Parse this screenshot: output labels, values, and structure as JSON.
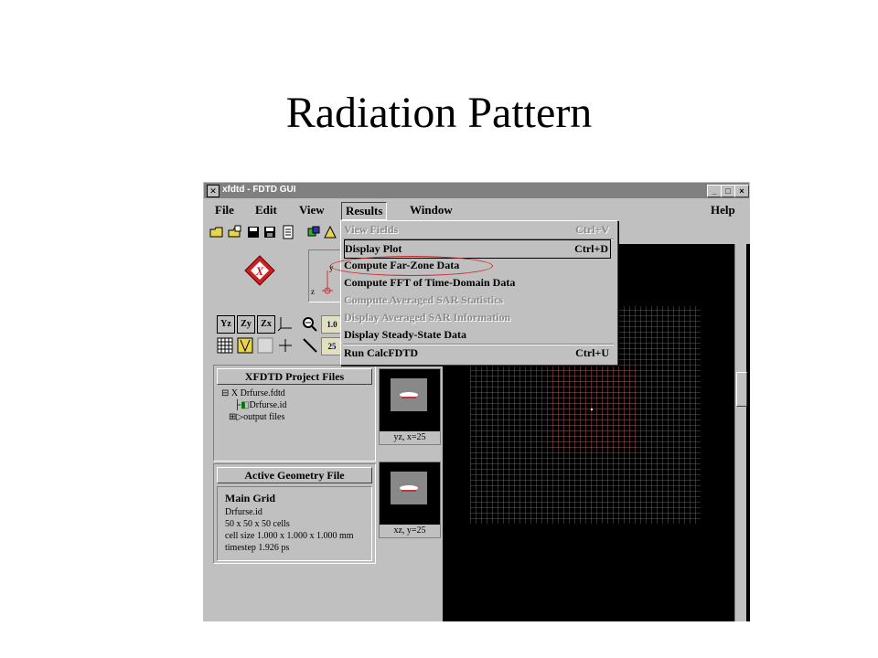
{
  "slide": {
    "title": "Radiation Pattern"
  },
  "window": {
    "title": "xfdtd - FDTD GUI",
    "controls": [
      "_",
      "□",
      "×"
    ]
  },
  "menubar": {
    "file": "File",
    "edit": "Edit",
    "view": "View",
    "results": "Results",
    "window": "Window",
    "help": "Help"
  },
  "results_menu": {
    "items": [
      {
        "label": "View Fields",
        "shortcut": "Ctrl+V",
        "enabled": false
      },
      {
        "label": "Display Plot",
        "shortcut": "Ctrl+D",
        "enabled": true
      },
      {
        "label": "Compute Far-Zone Data",
        "shortcut": "",
        "enabled": true,
        "highlighted": true
      },
      {
        "label": "Compute FFT of Time-Domain Data",
        "shortcut": "",
        "enabled": true
      },
      {
        "label": "Compute Averaged SAR Statistics",
        "shortcut": "",
        "enabled": false
      },
      {
        "label": "Display Averaged SAR Information",
        "shortcut": "",
        "enabled": false
      },
      {
        "label": "Display Steady-State Data",
        "shortcut": "",
        "enabled": true
      },
      {
        "label": "Run CalcFDTD",
        "shortcut": "Ctrl+U",
        "enabled": true
      }
    ],
    "highlight_color": "#cc2222"
  },
  "toolbar": {
    "zoom_value": "1.0",
    "step_value": "25",
    "axis_labels": {
      "z": "z",
      "y": "y"
    },
    "view_buttons": [
      "Yz",
      "Zy",
      "Zx"
    ]
  },
  "project_panel": {
    "header": "XFDTD Project Files",
    "tree": [
      "X Drfurse.fdtd",
      "Drfurse.id",
      "output files"
    ]
  },
  "geometry_panel": {
    "header": "Active Geometry File",
    "title": "Main Grid",
    "lines": [
      "Drfurse.id",
      "50 x 50 x 50 cells",
      "cell size 1.000 x 1.000 x 1.000 mm",
      "timestep 1.926 ps"
    ]
  },
  "views": [
    {
      "label": "yz, x=25"
    },
    {
      "label": "xz, y=25"
    }
  ],
  "grid": {
    "line_color": "#7a7a7a",
    "highlight_color": "#d05050"
  }
}
